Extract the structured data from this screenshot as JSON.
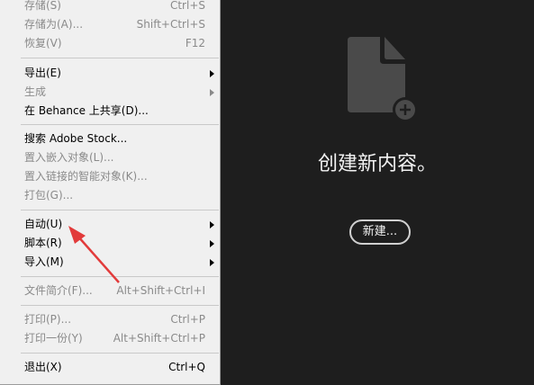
{
  "menu": {
    "items": [
      {
        "label": "存储(S)",
        "shortcut": "Ctrl+S",
        "disabled": true,
        "submenu": false
      },
      {
        "label": "存储为(A)...",
        "shortcut": "Shift+Ctrl+S",
        "disabled": true,
        "submenu": false
      },
      {
        "label": "恢复(V)",
        "shortcut": "F12",
        "disabled": true,
        "submenu": false
      },
      {
        "label": "导出(E)",
        "shortcut": "",
        "disabled": false,
        "submenu": true
      },
      {
        "label": "生成",
        "shortcut": "",
        "disabled": true,
        "submenu": true
      },
      {
        "label": "在 Behance 上共享(D)...",
        "shortcut": "",
        "disabled": false,
        "submenu": false
      },
      {
        "label": "搜索 Adobe Stock...",
        "shortcut": "",
        "disabled": false,
        "submenu": false
      },
      {
        "label": "置入嵌入对象(L)...",
        "shortcut": "",
        "disabled": true,
        "submenu": false
      },
      {
        "label": "置入链接的智能对象(K)...",
        "shortcut": "",
        "disabled": true,
        "submenu": false
      },
      {
        "label": "打包(G)...",
        "shortcut": "",
        "disabled": true,
        "submenu": false
      },
      {
        "label": "自动(U)",
        "shortcut": "",
        "disabled": false,
        "submenu": true
      },
      {
        "label": "脚本(R)",
        "shortcut": "",
        "disabled": false,
        "submenu": true
      },
      {
        "label": "导入(M)",
        "shortcut": "",
        "disabled": false,
        "submenu": true
      },
      {
        "label": "文件简介(F)...",
        "shortcut": "Alt+Shift+Ctrl+I",
        "disabled": true,
        "submenu": false
      },
      {
        "label": "打印(P)...",
        "shortcut": "Ctrl+P",
        "disabled": true,
        "submenu": false
      },
      {
        "label": "打印一份(Y)",
        "shortcut": "Alt+Shift+Ctrl+P",
        "disabled": true,
        "submenu": false
      },
      {
        "label": "退出(X)",
        "shortcut": "Ctrl+Q",
        "disabled": false,
        "submenu": false
      }
    ]
  },
  "empty_state": {
    "icon": "new-document-icon",
    "headline": "创建新内容。",
    "new_button": "新建..."
  },
  "colors": {
    "background": "#1e1e1e",
    "menu_bg": "#f0f0f0",
    "annotation_arrow": "#e23b3b"
  }
}
